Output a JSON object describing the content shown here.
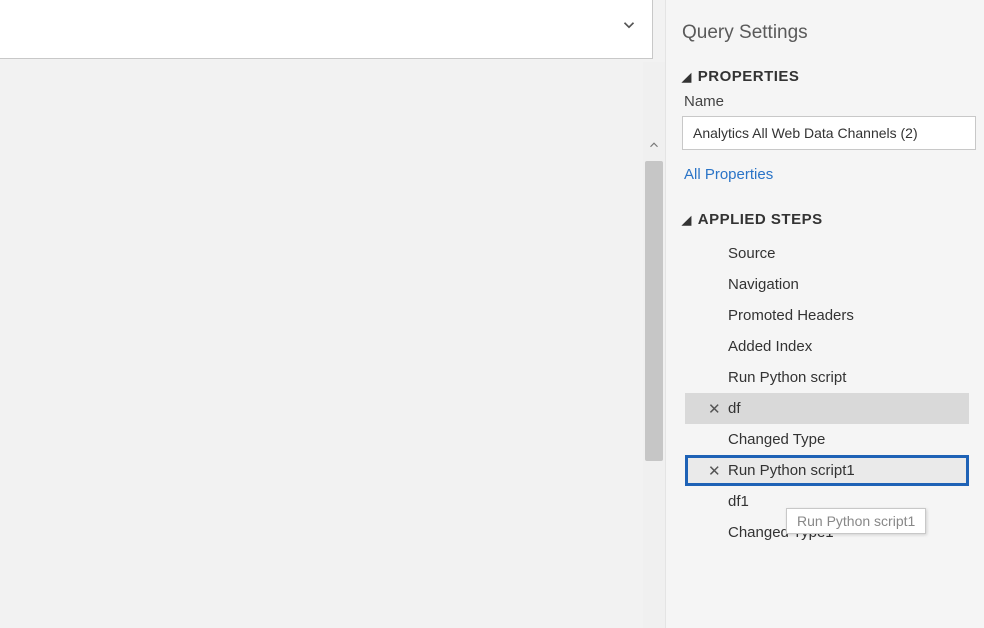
{
  "panel": {
    "title": "Query Settings"
  },
  "properties": {
    "heading": "PROPERTIES",
    "name_label": "Name",
    "name_value": "Analytics All Web Data Channels (2)",
    "all_link": "All Properties"
  },
  "applied": {
    "heading": "APPLIED STEPS",
    "steps": [
      {
        "label": "Source"
      },
      {
        "label": "Navigation"
      },
      {
        "label": "Promoted Headers"
      },
      {
        "label": "Added Index"
      },
      {
        "label": "Run Python script"
      },
      {
        "label": "df"
      },
      {
        "label": "Changed Type"
      },
      {
        "label": "Run Python script1"
      },
      {
        "label": "df1"
      },
      {
        "label": "Changed Type1"
      }
    ]
  },
  "tooltip": "Run Python script1"
}
